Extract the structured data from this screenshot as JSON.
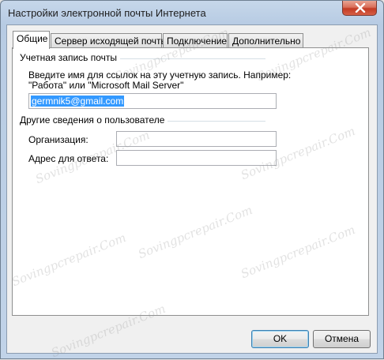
{
  "window": {
    "title": "Настройки электронной почты Интернета"
  },
  "tabs": [
    {
      "label": "Общие",
      "active": true
    },
    {
      "label": "Сервер исходящей почты",
      "active": false
    },
    {
      "label": "Подключение",
      "active": false
    },
    {
      "label": "Дополнительно",
      "active": false
    }
  ],
  "account_group": {
    "title": "Учетная запись почты",
    "description_line1": "Введите имя для ссылок на эту учетную запись. Например:",
    "description_line2": "\"Работа\" или \"Microsoft Mail Server\"",
    "account_name_value": "germnik5@gmail.com"
  },
  "user_group": {
    "title": "Другие сведения о пользователе",
    "organization_label": "Организация:",
    "organization_value": "",
    "reply_label": "Адрес для ответа:",
    "reply_value": ""
  },
  "buttons": {
    "ok": "OK",
    "cancel": "Отмена"
  },
  "watermark": "Sovingpcrepair.Com"
}
